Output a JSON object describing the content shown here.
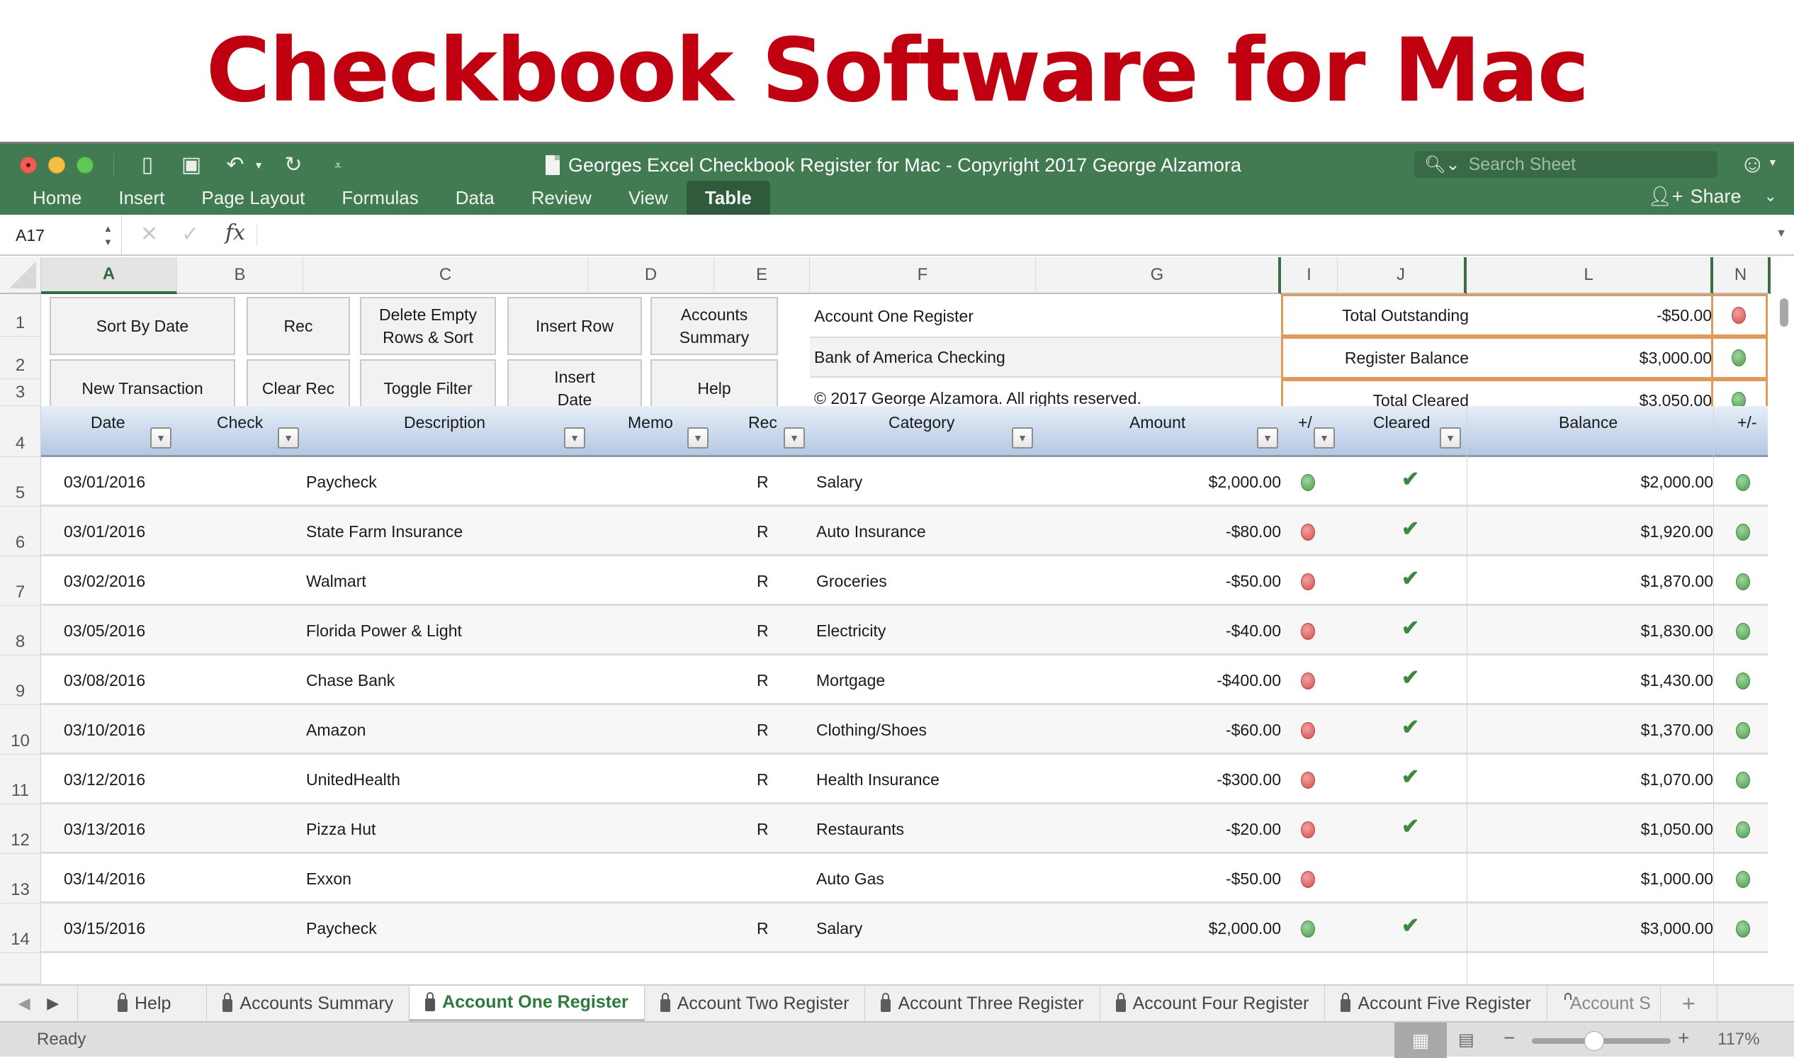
{
  "promo": {
    "title": "Checkbook Software for Mac"
  },
  "window": {
    "title": "Georges Excel Checkbook Register for Mac - Copyright 2017 George Alzamora",
    "search_placeholder": "Search Sheet",
    "share_label": "Share",
    "ribbon_tabs": [
      {
        "label": "Home",
        "active": false
      },
      {
        "label": "Insert",
        "active": false
      },
      {
        "label": "Page Layout",
        "active": false
      },
      {
        "label": "Formulas",
        "active": false
      },
      {
        "label": "Data",
        "active": false
      },
      {
        "label": "Review",
        "active": false
      },
      {
        "label": "View",
        "active": false
      },
      {
        "label": "Table",
        "active": true
      }
    ],
    "quick_access_icons": [
      "sidebar-icon",
      "save-icon",
      "undo-icon",
      "redo-icon",
      "customize-icon"
    ]
  },
  "formula_bar": {
    "name_box": "A17",
    "fx_label": "fx",
    "formula": ""
  },
  "columns": [
    "A",
    "B",
    "C",
    "D",
    "E",
    "F",
    "G",
    "I",
    "J",
    "L",
    "N"
  ],
  "selected_column": "A",
  "row_numbers": [
    "1",
    "2",
    "3",
    "4",
    "5",
    "6",
    "7",
    "8",
    "9",
    "10",
    "11",
    "12",
    "13",
    "14"
  ],
  "buttons": {
    "sort_by_date": "Sort By Date",
    "rec": "Rec",
    "delete_empty": "Delete Empty Rows & Sort",
    "insert_row": "Insert Row",
    "accounts_summary": "Accounts Summary",
    "new_transaction": "New Transaction",
    "clear_rec": "Clear Rec",
    "toggle_filter": "Toggle Filter",
    "insert_date": "Insert Date",
    "help": "Help"
  },
  "info": {
    "register_name": "Account One Register",
    "bank_name": "Bank of America Checking",
    "copyright": "© 2017 George Alzamora.  All rights reserved."
  },
  "summary": [
    {
      "label": "Total Outstanding",
      "value": "-$50.00",
      "status": "red"
    },
    {
      "label": "Register Balance",
      "value": "$3,000.00",
      "status": "green"
    },
    {
      "label": "Total Cleared",
      "value": "$3,050.00",
      "status": "green"
    }
  ],
  "table": {
    "headers": {
      "date": "Date",
      "check": "Check",
      "description": "Description",
      "memo": "Memo",
      "rec": "Rec",
      "category": "Category",
      "amount": "Amount",
      "sign": "+/",
      "cleared": "Cleared",
      "balance": "Balance",
      "balance_sign": "+/-"
    },
    "rows": [
      {
        "date": "03/01/2016",
        "check": "",
        "description": "Paycheck",
        "memo": "",
        "rec": "R",
        "category": "Salary",
        "amount": "$2,000.00",
        "sign": "green",
        "cleared": true,
        "balance": "$2,000.00",
        "balance_sign": "green"
      },
      {
        "date": "03/01/2016",
        "check": "",
        "description": "State Farm Insurance",
        "memo": "",
        "rec": "R",
        "category": "Auto Insurance",
        "amount": "-$80.00",
        "sign": "red",
        "cleared": true,
        "balance": "$1,920.00",
        "balance_sign": "green"
      },
      {
        "date": "03/02/2016",
        "check": "",
        "description": "Walmart",
        "memo": "",
        "rec": "R",
        "category": "Groceries",
        "amount": "-$50.00",
        "sign": "red",
        "cleared": true,
        "balance": "$1,870.00",
        "balance_sign": "green"
      },
      {
        "date": "03/05/2016",
        "check": "",
        "description": "Florida Power & Light",
        "memo": "",
        "rec": "R",
        "category": "Electricity",
        "amount": "-$40.00",
        "sign": "red",
        "cleared": true,
        "balance": "$1,830.00",
        "balance_sign": "green"
      },
      {
        "date": "03/08/2016",
        "check": "",
        "description": "Chase Bank",
        "memo": "",
        "rec": "R",
        "category": "Mortgage",
        "amount": "-$400.00",
        "sign": "red",
        "cleared": true,
        "balance": "$1,430.00",
        "balance_sign": "green"
      },
      {
        "date": "03/10/2016",
        "check": "",
        "description": "Amazon",
        "memo": "",
        "rec": "R",
        "category": "Clothing/Shoes",
        "amount": "-$60.00",
        "sign": "red",
        "cleared": true,
        "balance": "$1,370.00",
        "balance_sign": "green"
      },
      {
        "date": "03/12/2016",
        "check": "",
        "description": "UnitedHealth",
        "memo": "",
        "rec": "R",
        "category": "Health Insurance",
        "amount": "-$300.00",
        "sign": "red",
        "cleared": true,
        "balance": "$1,070.00",
        "balance_sign": "green"
      },
      {
        "date": "03/13/2016",
        "check": "",
        "description": "Pizza Hut",
        "memo": "",
        "rec": "R",
        "category": "Restaurants",
        "amount": "-$20.00",
        "sign": "red",
        "cleared": true,
        "balance": "$1,050.00",
        "balance_sign": "green"
      },
      {
        "date": "03/14/2016",
        "check": "",
        "description": "Exxon",
        "memo": "",
        "rec": "",
        "category": "Auto Gas",
        "amount": "-$50.00",
        "sign": "red",
        "cleared": false,
        "balance": "$1,000.00",
        "balance_sign": "green"
      },
      {
        "date": "03/15/2016",
        "check": "",
        "description": "Paycheck",
        "memo": "",
        "rec": "R",
        "category": "Salary",
        "amount": "$2,000.00",
        "sign": "green",
        "cleared": true,
        "balance": "$3,000.00",
        "balance_sign": "green"
      }
    ]
  },
  "sheet_tabs": [
    {
      "label": "Help",
      "active": false
    },
    {
      "label": "Accounts Summary",
      "active": false
    },
    {
      "label": "Account One Register",
      "active": true
    },
    {
      "label": "Account Two Register",
      "active": false
    },
    {
      "label": "Account Three Register",
      "active": false
    },
    {
      "label": "Account Four Register",
      "active": false
    },
    {
      "label": "Account Five Register",
      "active": false
    },
    {
      "label": "Account S",
      "active": false
    }
  ],
  "status": {
    "text": "Ready",
    "zoom": "117%",
    "zoom_slider_fraction": 0.45
  },
  "colors": {
    "ribbon_green": "#427a52",
    "title_red": "#c00010",
    "summary_border": "#e09b5a",
    "status_green": "#4e9c4f",
    "status_red": "#d45050",
    "check_green": "#3d8a3e"
  }
}
